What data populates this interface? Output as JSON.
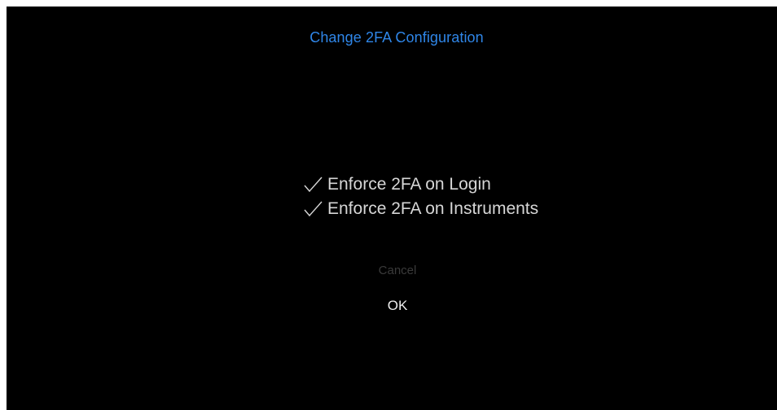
{
  "dialog": {
    "title": "Change 2FA Configuration",
    "options": [
      {
        "label": "Enforce 2FA on Login",
        "checked": true,
        "icon": "checkmark-icon"
      },
      {
        "label": "Enforce 2FA on Instruments",
        "checked": true,
        "icon": "checkmark-icon"
      }
    ],
    "cancel_label": "Cancel",
    "ok_label": "OK"
  },
  "colors": {
    "background": "#000000",
    "title": "#2f86e8",
    "option_text": "#d6d6d6",
    "cancel_text": "#3a3a3a",
    "ok_text": "#eeeeee"
  }
}
